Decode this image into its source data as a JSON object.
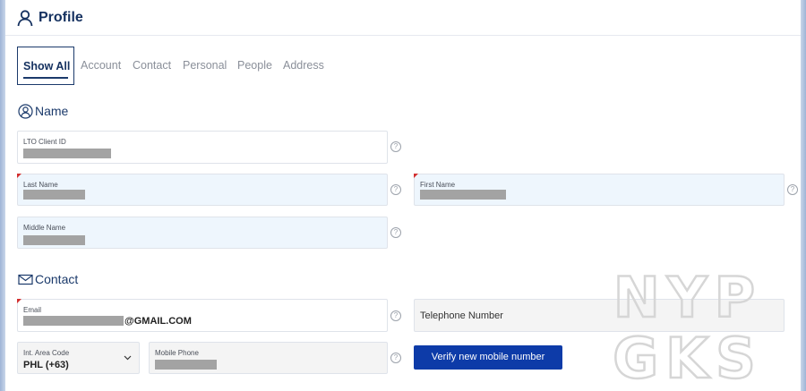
{
  "header": {
    "title": "Profile",
    "icon": "user-icon"
  },
  "tabs": [
    {
      "label": "Show All",
      "active": true
    },
    {
      "label": "Account",
      "active": false
    },
    {
      "label": "Contact",
      "active": false
    },
    {
      "label": "Personal",
      "active": false
    },
    {
      "label": "People",
      "active": false
    },
    {
      "label": "Address",
      "active": false
    }
  ],
  "name_section": {
    "title": "Name",
    "icon": "user-circle-icon",
    "fields": {
      "client_id": {
        "label": "LTO Client ID"
      },
      "last_name": {
        "label": "Last Name"
      },
      "first_name": {
        "label": "First Name"
      },
      "middle_name": {
        "label": "Middle Name"
      }
    }
  },
  "contact_section": {
    "title": "Contact",
    "icon": "envelope-icon",
    "fields": {
      "email": {
        "label": "Email",
        "suffix": "@GMAIL.COM"
      },
      "telephone": {
        "placeholder": "Telephone Number"
      },
      "area_code": {
        "label": "Int. Area Code",
        "value": "PHL (+63)"
      },
      "mobile": {
        "label": "Mobile Phone"
      }
    },
    "verify_button": "Verify new mobile number"
  },
  "help_glyph": "?",
  "watermark": {
    "line1": "NYP",
    "line2": "GKS"
  },
  "colors": {
    "brand": "#14305f",
    "button": "#0d3ba8",
    "required": "#d32f2f",
    "field_blue": "#eef6fd"
  }
}
